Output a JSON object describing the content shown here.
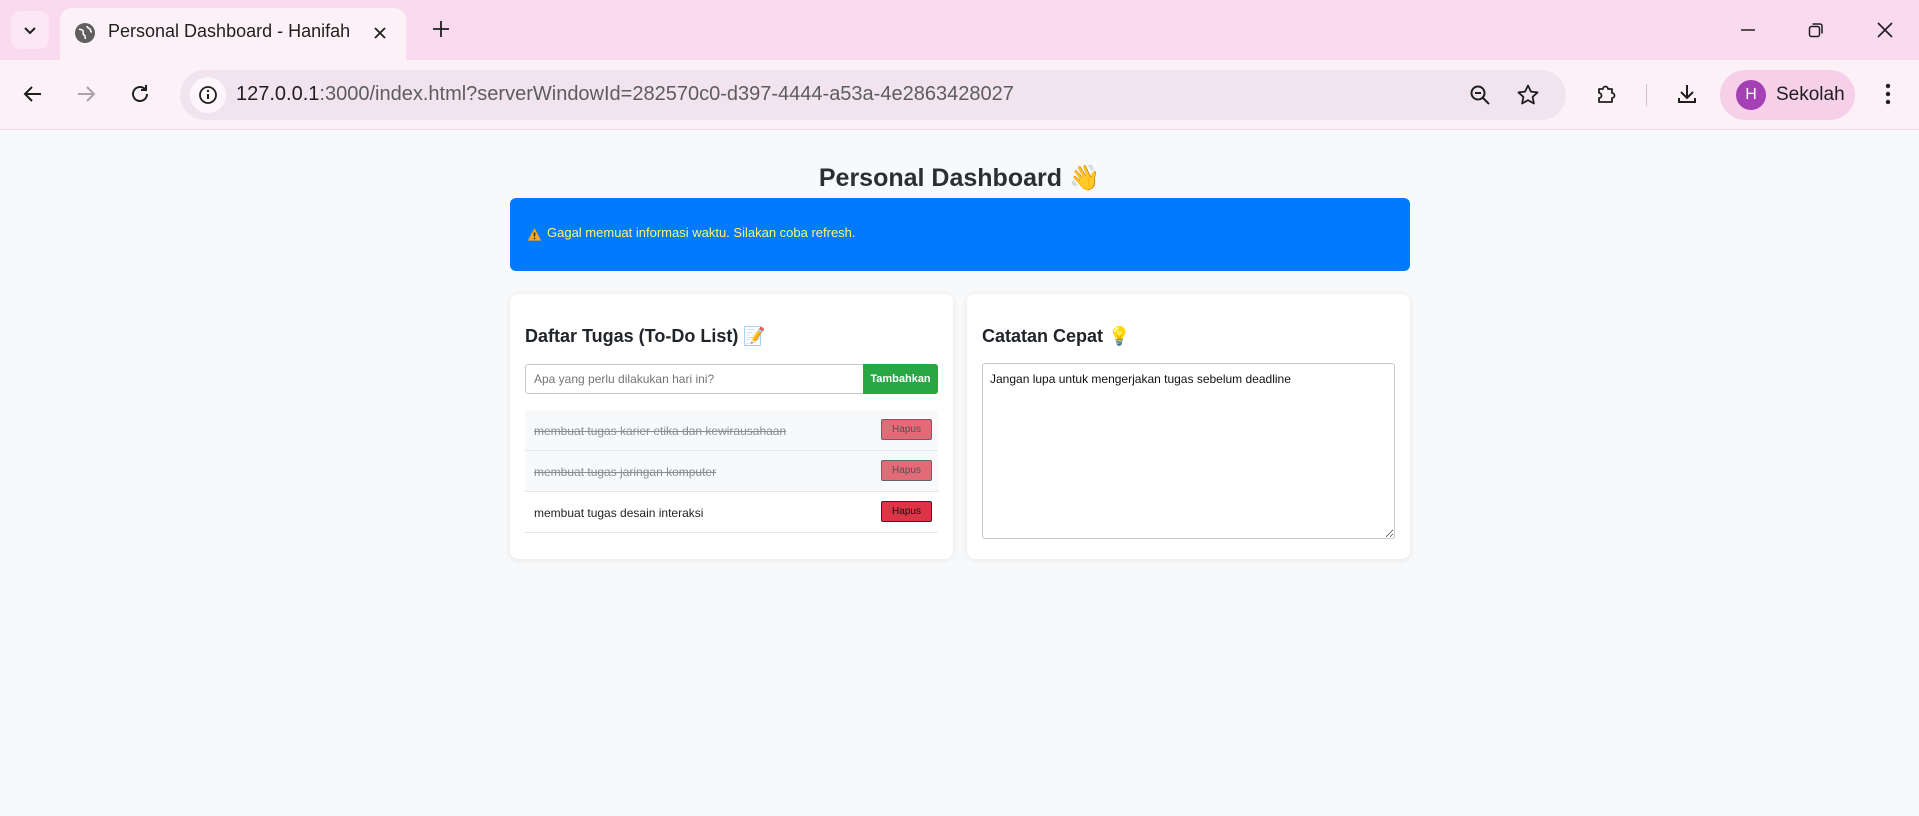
{
  "browser": {
    "tab": {
      "title": "Personal Dashboard - Hanifah"
    },
    "address_bar": {
      "host": "127.0.0.1",
      "rest": ":3000/index.html?serverWindowId=282570c0-d397-4444-a53a-4e2863428027"
    },
    "profile": {
      "initial": "H",
      "name": "Sekolah"
    }
  },
  "page": {
    "title": "Personal Dashboard",
    "title_emoji": "👋",
    "alert": {
      "icon": "warning-icon",
      "text": "Gagal memuat informasi waktu. Silakan coba refresh."
    }
  },
  "todo": {
    "title": "Daftar Tugas (To-Do List)",
    "title_emoji": "📝",
    "input_placeholder": "Apa yang perlu dilakukan hari ini?",
    "add_label": "Tambahkan",
    "delete_label": "Hapus",
    "items": [
      {
        "text": "membuat tugas karier etika dan kewirausahaan",
        "done": true
      },
      {
        "text": "membuat tugas jaringan komputer",
        "done": true
      },
      {
        "text": "membuat tugas desain interaksi",
        "done": false
      }
    ]
  },
  "notes": {
    "title": "Catatan Cepat",
    "title_emoji": "💡",
    "content": "Jangan lupa untuk mengerjakan tugas sebelum deadline"
  },
  "colors": {
    "tabstrip": "#f9daee",
    "toolbar": "#fdf1f8",
    "alert_bg": "#007bff",
    "alert_text": "#fff27a",
    "add_button": "#28a745",
    "delete_button": "#dc3545"
  }
}
